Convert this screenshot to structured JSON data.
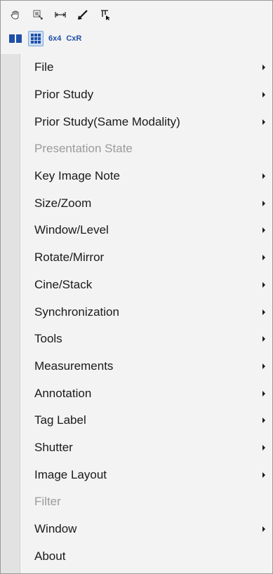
{
  "toolbar": {
    "icons": [
      "pan-hand-icon",
      "window-level-icon",
      "measure-distance-icon",
      "arrow-annotation-icon",
      "cursor-select-icon"
    ],
    "layout_buttons": [
      "series-layout-icon",
      "image-layout-grid-icon"
    ],
    "layout_6x4_label": "6x4",
    "layout_cxr_label": "CxR"
  },
  "menu": {
    "items": [
      {
        "label": "File",
        "submenu": true,
        "enabled": true
      },
      {
        "label": "Prior Study",
        "submenu": true,
        "enabled": true
      },
      {
        "label": "Prior Study(Same Modality)",
        "submenu": true,
        "enabled": true
      },
      {
        "label": "Presentation State",
        "submenu": false,
        "enabled": false
      },
      {
        "label": "Key Image Note",
        "submenu": true,
        "enabled": true
      },
      {
        "label": "Size/Zoom",
        "submenu": true,
        "enabled": true
      },
      {
        "label": "Window/Level",
        "submenu": true,
        "enabled": true
      },
      {
        "label": "Rotate/Mirror",
        "submenu": true,
        "enabled": true
      },
      {
        "label": "Cine/Stack",
        "submenu": true,
        "enabled": true
      },
      {
        "label": "Synchronization",
        "submenu": true,
        "enabled": true
      },
      {
        "label": "Tools",
        "submenu": true,
        "enabled": true
      },
      {
        "label": "Measurements",
        "submenu": true,
        "enabled": true
      },
      {
        "label": "Annotation",
        "submenu": true,
        "enabled": true
      },
      {
        "label": "Tag Label",
        "submenu": true,
        "enabled": true
      },
      {
        "label": "Shutter",
        "submenu": true,
        "enabled": true
      },
      {
        "label": "Image Layout",
        "submenu": true,
        "enabled": true
      },
      {
        "label": "Filter",
        "submenu": false,
        "enabled": false
      },
      {
        "label": "Window",
        "submenu": true,
        "enabled": true
      },
      {
        "label": "About",
        "submenu": false,
        "enabled": true
      }
    ]
  },
  "colors": {
    "accent_blue": "#1f4fa8",
    "disabled_text": "#9b9b9b"
  }
}
